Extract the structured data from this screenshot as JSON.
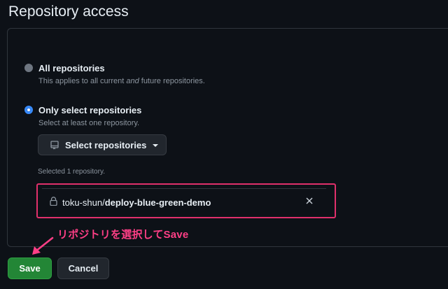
{
  "section": {
    "title": "Repository access"
  },
  "options": [
    {
      "label": "All repositories",
      "description_pre": "This applies to all current ",
      "description_em": "and",
      "description_post": " future repositories.",
      "selected": false
    },
    {
      "label": "Only select repositories",
      "description": "Select at least one repository.",
      "selected": true
    }
  ],
  "select_button": {
    "label": "Select repositories",
    "icon": "repo-icon"
  },
  "selected_count": "Selected 1 repository.",
  "selected_repo": {
    "owner": "toku-shun/",
    "name": "deploy-blue-green-demo",
    "icon": "lock-icon"
  },
  "annotation": {
    "text": "リポジトリを選択してSave",
    "color": "#ff3f86"
  },
  "actions": {
    "save_label": "Save",
    "cancel_label": "Cancel"
  },
  "colors": {
    "background": "#0d1117",
    "accent": "#388bfd",
    "save": "#238636",
    "highlight": "#e0306b"
  }
}
